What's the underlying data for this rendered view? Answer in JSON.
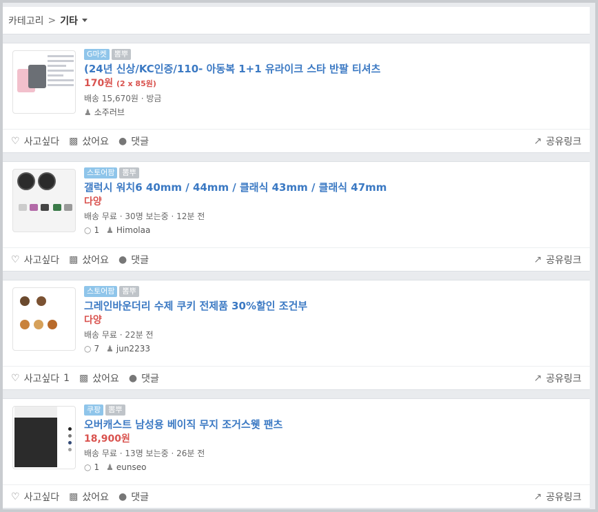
{
  "breadcrumb": {
    "root": "카테고리",
    "separator": ">",
    "current": "기타"
  },
  "actions": {
    "want": "사고싶다",
    "bought": "샀어요",
    "comment": "댓글",
    "share": "공유링크"
  },
  "posts": [
    {
      "tags": [
        "G마켓",
        "뽐뿌"
      ],
      "title": "(24년 신상/KC인증/110- 아동복 1+1 유라이크 스타 반팔 티셔츠",
      "price": "170원",
      "price_note": "(2 x 85원)",
      "meta": "배송 15,670원 · 방금",
      "comments": "",
      "user": "소주러브",
      "want_count": ""
    },
    {
      "tags": [
        "스토어팜",
        "뽐뿌"
      ],
      "title": "갤럭시 워치6 40mm / 44mm / 클래식 43mm / 클래식 47mm",
      "price": "다양",
      "price_note": "",
      "meta": "배송 무료 · 30명 보는중 · 12분 전",
      "comments": "1",
      "user": "Himolaa",
      "want_count": ""
    },
    {
      "tags": [
        "스토어팜",
        "뽐뿌"
      ],
      "title": "그레인바운더리 수제 쿠키 전제품 30%할인 조건부",
      "price": "다양",
      "price_note": "",
      "meta": "배송 무료 · 22분 전",
      "comments": "7",
      "user": "jun2233",
      "want_count": "1"
    },
    {
      "tags": [
        "쿠팡",
        "뽐뿌"
      ],
      "title": "오버캐스트 남성용 베이직 무지 조거스웻 팬츠",
      "price": "18,900원",
      "price_note": "",
      "meta": "배송 무료 · 13명 보는중 · 26분 전",
      "comments": "1",
      "user": "eunseo",
      "want_count": ""
    }
  ],
  "colors": {
    "title": "#3b79c3",
    "price": "#d9534f",
    "tag_store": "#8fc5ea",
    "tag_etc": "#bfc4c9"
  },
  "icons": [
    "heart-icon",
    "shopping-bag-icon",
    "comment-icon",
    "share-icon",
    "user-icon",
    "caret-down-icon"
  ]
}
